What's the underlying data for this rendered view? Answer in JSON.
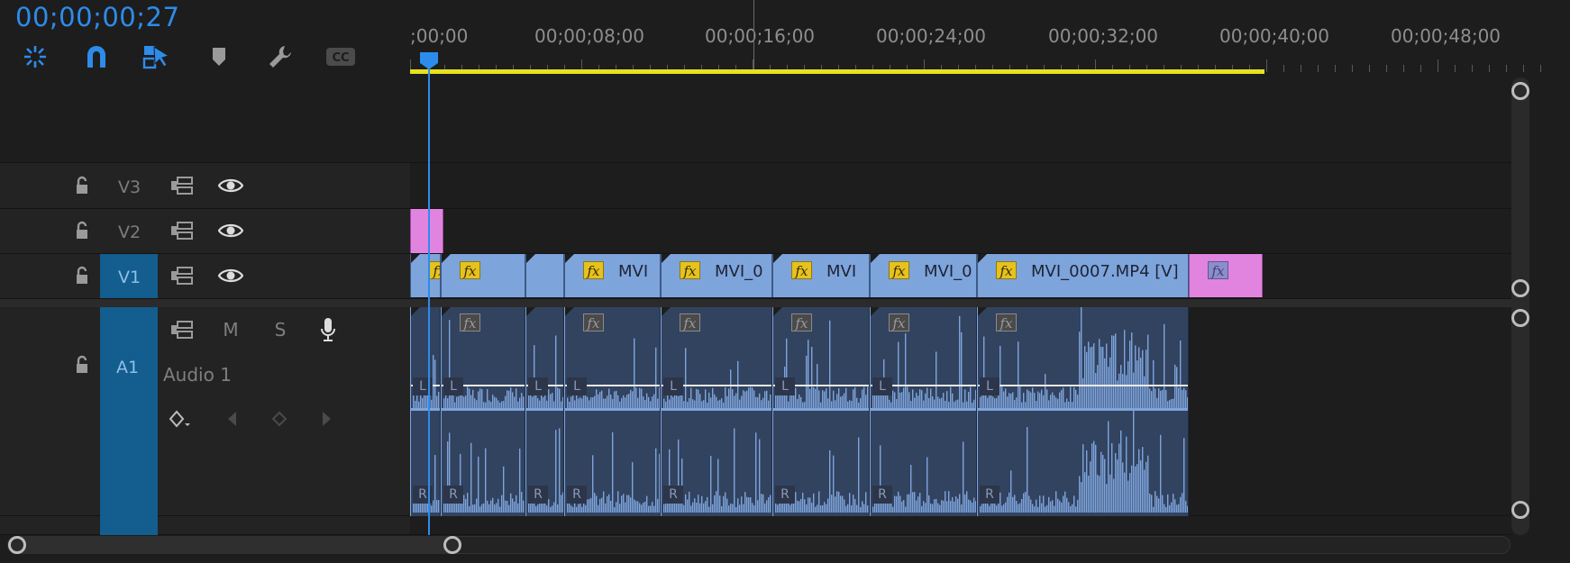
{
  "timecode": "00;00;00;27",
  "toolbar": {
    "icons": [
      "nest-sequence-icon",
      "snap-magnet-icon",
      "linked-selection-icon",
      "add-marker-icon",
      "settings-wrench-icon",
      "captions-cc-icon"
    ],
    "cc_label": "CC"
  },
  "ruler": {
    "labels": [
      ";00;00",
      "00;00;08;00",
      "00;00;16;00",
      "00;00;24;00",
      "00;00;32;00",
      "00;00;40;00",
      "00;00;48;00"
    ]
  },
  "playhead": {
    "timecode": "00;00;00;27"
  },
  "tracks": {
    "v3": {
      "name": "V3"
    },
    "v2": {
      "name": "V2"
    },
    "v1": {
      "name": "V1"
    },
    "a1": {
      "name": "A1",
      "label": "Audio 1",
      "mute": "M",
      "solo": "S"
    }
  },
  "video_clips": [
    {
      "name": "",
      "fx": true
    },
    {
      "name": "",
      "fx": true
    },
    {
      "name": "",
      "fx": false
    },
    {
      "name": "MVI",
      "fx": true
    },
    {
      "name": "MVI_0",
      "fx": true
    },
    {
      "name": "MVI",
      "fx": true
    },
    {
      "name": "MVI_0",
      "fx": true
    },
    {
      "name": "MVI_0007.MP4 [V]",
      "fx": true
    },
    {
      "name": "",
      "fx": true
    }
  ],
  "audio_channels": {
    "left": "L",
    "right": "R"
  },
  "colors": {
    "accent_blue": "#2d8ceb",
    "work_area_yellow": "#e8e21d",
    "video_clip": "#7ea4dc",
    "pink_clip": "#e184e0",
    "audio_clip": "#32435f",
    "selected_track": "#135d8f"
  }
}
